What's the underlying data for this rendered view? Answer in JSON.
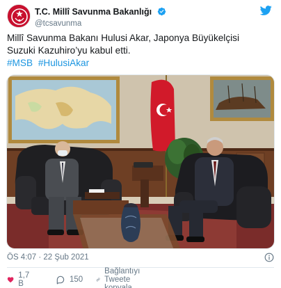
{
  "account": {
    "display_name": "T.C. Millî Savunma Bakanlığı",
    "handle": "@tcsavunma"
  },
  "tweet": {
    "text_line1": "Millî Savunma Bakanı Hulusi Akar, Japonya Büyükelçisi",
    "text_line2": "Suzuki Kazuhiro’yu kabul etti.",
    "hashtags": [
      "#MSB",
      "#HulusiAkar"
    ]
  },
  "meta": {
    "timestamp": "ÖS 4:07 · 22 Şub 2021"
  },
  "actions": {
    "likes": "1,7 B",
    "replies": "150",
    "copy_link": "Bağlantıyı Tweete kopyala"
  },
  "colors": {
    "link": "#1b95e0",
    "like": "#e0245e",
    "twitter_blue": "#1da1f2",
    "muted": "#657786"
  },
  "icons": [
    "msb-logo-icon",
    "verified-badge-icon",
    "twitter-bird-icon",
    "info-icon",
    "heart-icon",
    "reply-icon",
    "link-icon"
  ]
}
